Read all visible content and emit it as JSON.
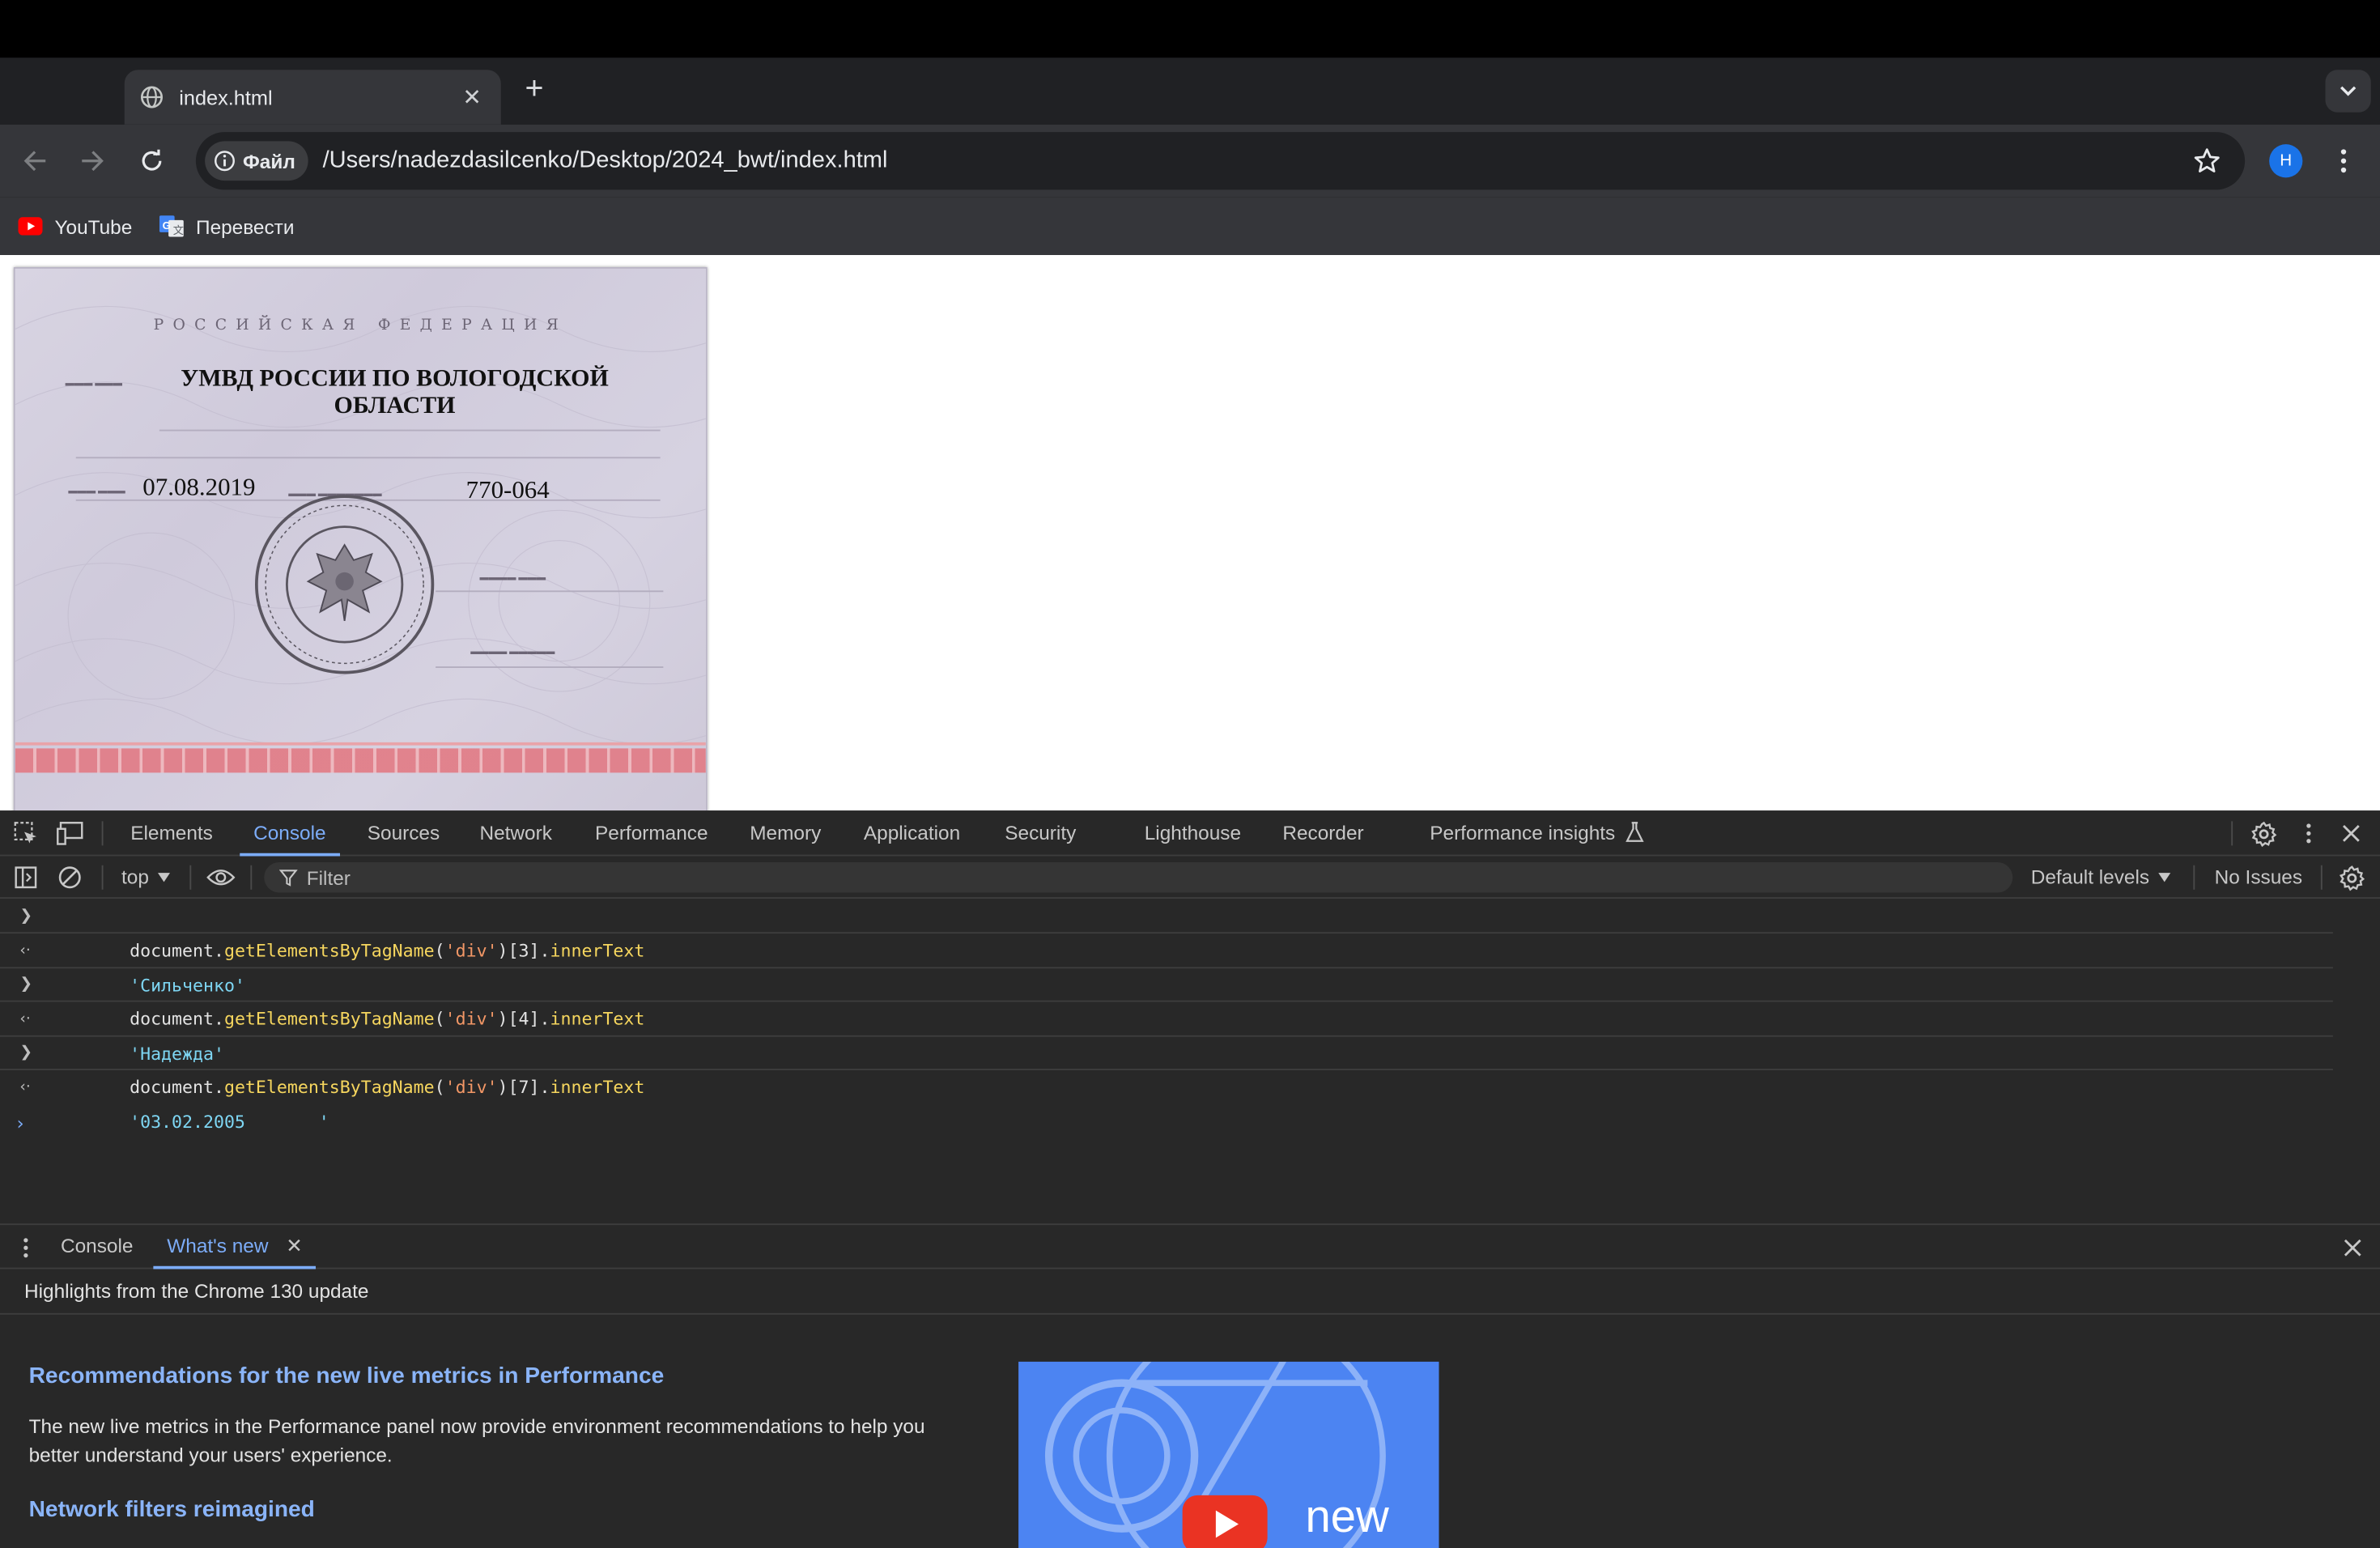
{
  "browser": {
    "tab_title": "index.html",
    "address_chip": "Файл",
    "url": "/Users/nadezdasilcenko/Desktop/2024_bwt/index.html",
    "profile_initial": "H",
    "bookmarks": [
      {
        "label": "YouTube",
        "icon": "youtube-icon"
      },
      {
        "label": "Перевести",
        "icon": "google-translate-icon"
      }
    ]
  },
  "page": {
    "passport": {
      "country_header": "РОССИЙСКАЯ ФЕДЕРАЦИЯ",
      "issuer": "УМВД РОССИИ ПО ВОЛОГОДСКОЙ ОБЛАСТИ",
      "issue_date": "07.08.2019",
      "department_code": "770-064"
    }
  },
  "devtools": {
    "tabs": [
      "Elements",
      "Console",
      "Sources",
      "Network",
      "Performance",
      "Memory",
      "Application",
      "Security",
      "Lighthouse",
      "Recorder",
      "Performance insights"
    ],
    "active_tab": "Console",
    "context": "top",
    "filter_placeholder": "Filter",
    "levels": "Default levels",
    "issues": "No Issues",
    "console": [
      {
        "type": "input",
        "obj": "document",
        "dot1": ".",
        "method": "getElementsByTagName",
        "open": "(",
        "arg": "'div'",
        "close": ")",
        "index": "[3]",
        "dot2": ".",
        "prop": "innerText"
      },
      {
        "type": "result",
        "text": "'Сильченко'"
      },
      {
        "type": "input",
        "obj": "document",
        "dot1": ".",
        "method": "getElementsByTagName",
        "open": "(",
        "arg": "'div'",
        "close": ")",
        "index": "[4]",
        "dot2": ".",
        "prop": "innerText"
      },
      {
        "type": "result",
        "text": "'Надежда'"
      },
      {
        "type": "input",
        "obj": "document",
        "dot1": ".",
        "method": "getElementsByTagName",
        "open": "(",
        "arg": "'div'",
        "close": ")",
        "index": "[7]",
        "dot2": ".",
        "prop": "innerText"
      },
      {
        "type": "result",
        "text": "'03.02.2005       '"
      }
    ],
    "drawer": {
      "tabs": [
        "Console",
        "What's new"
      ],
      "active": "What's new",
      "highlights": "Highlights from the Chrome 130 update",
      "heading1": "Recommendations for the new live metrics in Performance",
      "paragraph": "The new live metrics in the Performance panel now provide environment recommendations to help you better understand your users' experience.",
      "heading2": "Network filters reimagined",
      "video_label": "new"
    }
  },
  "colors": {
    "accent": "#7cacf8",
    "devtools_bg": "#282828",
    "chrome_bg": "#35363a",
    "string": "#f29766",
    "method": "#f6d65e",
    "result": "#7ed6f3"
  }
}
